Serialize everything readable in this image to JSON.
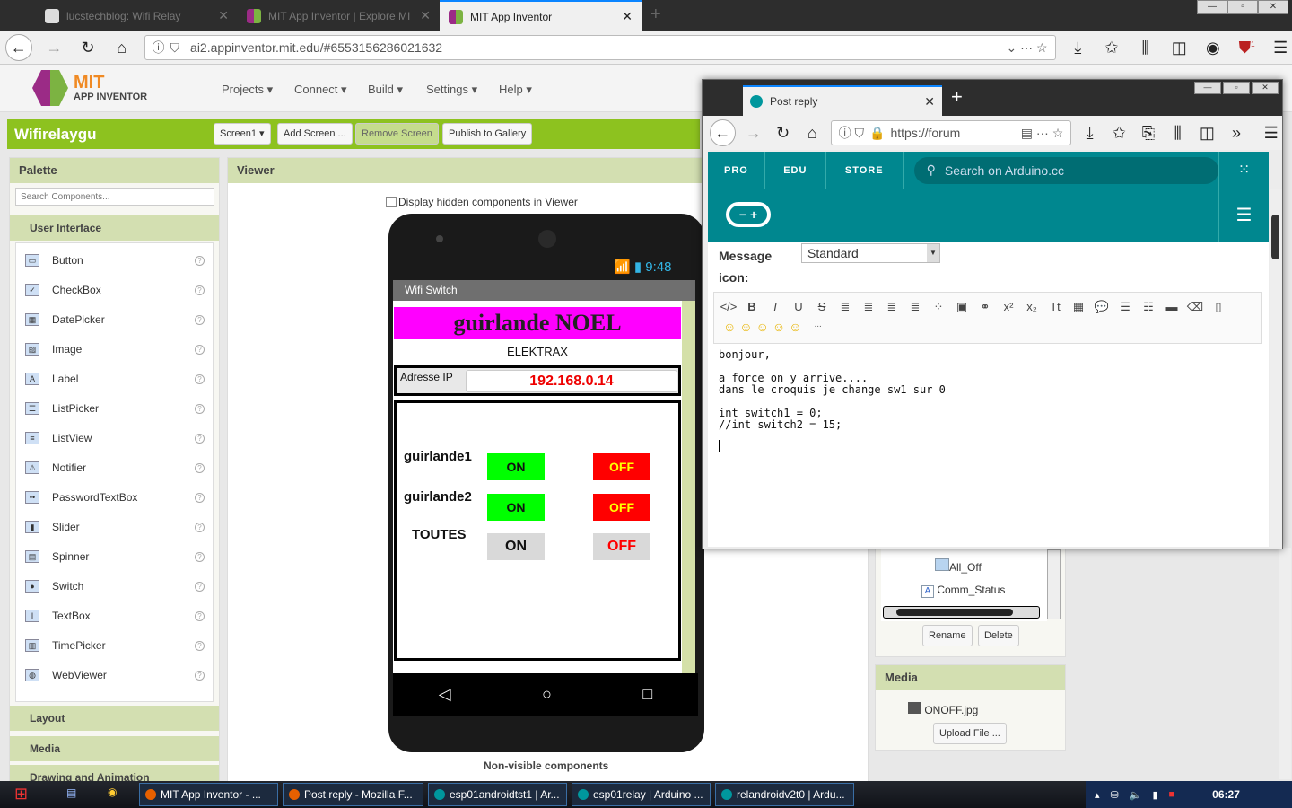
{
  "browser": {
    "tabs": [
      {
        "label": "lucstechblog: Wifi Relay"
      },
      {
        "label": "MIT App Inventor | Explore MI"
      },
      {
        "label": "MIT App Inventor"
      }
    ],
    "url": "ai2.appinventor.mit.edu/#6553156286021632",
    "badge": "1"
  },
  "appinventor": {
    "logo_mit": "MIT",
    "logo_sub": "APP INVENTOR",
    "menu": [
      "Projects ▾",
      "Connect ▾",
      "Build ▾",
      "Settings ▾",
      "Help ▾"
    ],
    "project": "Wifirelaygu",
    "screen_select": "Screen1 ▾",
    "buttons": {
      "add": "Add Screen ...",
      "remove": "Remove Screen",
      "publish": "Publish to Gallery"
    },
    "palette": {
      "title": "Palette",
      "search_placeholder": "Search Components...",
      "section": "User Interface",
      "items": [
        "Button",
        "CheckBox",
        "DatePicker",
        "Image",
        "Label",
        "ListPicker",
        "ListView",
        "Notifier",
        "PasswordTextBox",
        "Slider",
        "Spinner",
        "Switch",
        "TextBox",
        "TimePicker",
        "WebViewer"
      ],
      "groups": [
        "Layout",
        "Media",
        "Drawing and Animation"
      ]
    },
    "viewer": {
      "title": "Viewer",
      "hidden_checkbox": "Display hidden components in Viewer",
      "nonvisible": "Non-visible components"
    },
    "phone": {
      "time": "9:48",
      "title": "Wifi Switch",
      "header": "guirlande NOEL",
      "sub": "ELEKTRAX",
      "ip_label": "Adresse IP",
      "ip_value": "192.168.0.14",
      "rows": [
        {
          "label": "guirlande1",
          "on": "ON",
          "off": "OFF"
        },
        {
          "label": "guirlande2",
          "on": "ON",
          "off": "OFF"
        },
        {
          "label": "TOUTES",
          "on": "ON",
          "off": "OFF"
        }
      ]
    },
    "components": {
      "items": [
        "All_Off",
        "Comm_Status"
      ],
      "rename": "Rename",
      "delete": "Delete"
    },
    "media": {
      "title": "Media",
      "file": "ONOFF.jpg",
      "upload": "Upload File ..."
    }
  },
  "arduino_window": {
    "tab": "Post reply",
    "url": "https://forum",
    "nav": [
      "PRO",
      "EDU",
      "STORE"
    ],
    "search_placeholder": "Search on Arduino.cc",
    "message_icon_label": "Message icon:",
    "message_icon_value": "Standard",
    "editor_lines": [
      "bonjour,",
      "",
      "a force on y arrive....",
      "dans le croquis je change sw1 sur 0",
      "",
      "int switch1 = 0;",
      "//int switch2 = 15;"
    ]
  },
  "taskbar": {
    "items": [
      "MIT App Inventor - ...",
      "Post reply - Mozilla F...",
      "esp01androidtst1 | Ar...",
      "esp01relay | Arduino ...",
      "relandroidv2t0 | Ardu..."
    ],
    "clock": "06:27"
  }
}
